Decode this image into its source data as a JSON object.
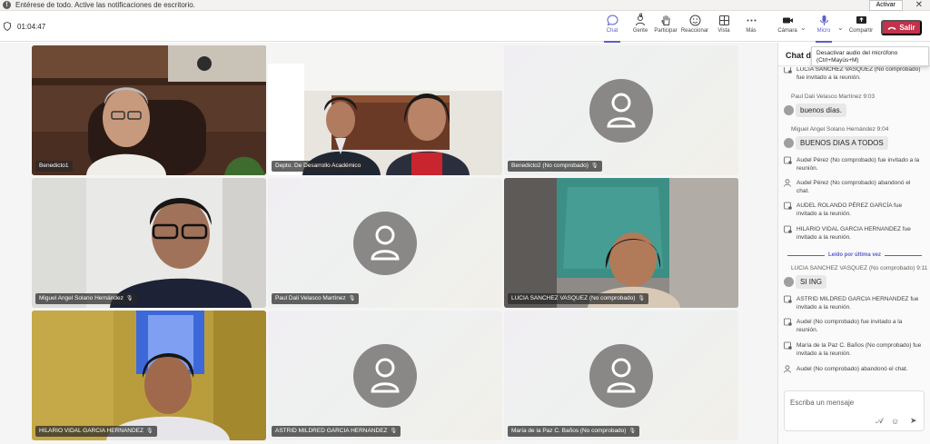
{
  "notification": {
    "text": "Entérese de todo. Active las notificaciones de escritorio.",
    "activate_label": "Activar",
    "close_label": "✕"
  },
  "toolbar": {
    "timer": "01:04:47",
    "people_count": "9",
    "buttons": {
      "chat": "Chat",
      "people": "Gente",
      "participate": "Participar",
      "react": "Reaccionar",
      "view": "Vista",
      "more": "Más",
      "camera": "Cámara",
      "mic": "Micro",
      "share": "Compartir"
    },
    "leave_label": "Salir",
    "leave_color": "#c4314b",
    "accent_color": "#5b5fc7"
  },
  "tooltip": {
    "line1": "Desactivar audio del micrófono",
    "line2": "(Ctrl+Mayús+M)"
  },
  "participants": [
    {
      "name": "Benedicto1",
      "muted": false,
      "video": true
    },
    {
      "name": "Depto. De Desarrollo Académico",
      "muted": false,
      "video": true
    },
    {
      "name": "Benedicto2 (No comprobado)",
      "muted": true,
      "video": false
    },
    {
      "name": "Miguel Angel Solano Hernández",
      "muted": true,
      "video": true
    },
    {
      "name": "Paul Dali Velasco Martínez",
      "muted": true,
      "video": false
    },
    {
      "name": "LUCIA SANCHEZ VASQUEZ (No comprobado)",
      "muted": true,
      "video": true
    },
    {
      "name": "HILARIO VIDAL GARCIA HERNANDEZ",
      "muted": true,
      "video": true
    },
    {
      "name": "ASTRID MILDRED GARCIA HERNANDEZ",
      "muted": true,
      "video": false
    },
    {
      "name": "María de la Paz C. Baños (No comprobado)",
      "muted": true,
      "video": false
    }
  ],
  "chat": {
    "title": "Chat de",
    "top_partial": "LUCIA SANCHEZ VASQUEZ (No comprobado) fue invitado a la reunión.",
    "msg1_meta": "Paul Dali Velasco Martínez  9:03",
    "msg1_text": "buenos días.",
    "msg2_meta": "Miguel Angel Solano Hernández  9:04",
    "msg2_text": "BUENOS DIAS A TODOS",
    "sys1": "Audel Pérez (No comprobado) fue invitado a la reunión.",
    "sys2": "Audel Pérez (No comprobado) abandonó el chat.",
    "sys3": "AUDEL ROLANDO PÉREZ GARCÍA fue invitado a la reunión.",
    "sys4": "HILARIO VIDAL GARCIA HERNANDEZ fue invitado a la reunión.",
    "last_read": "Leído por última vez",
    "msg3_meta": "LUCIA SANCHEZ VASQUEZ (No comprobado)  9:11",
    "msg3_text": "SI ING",
    "sys5": "ASTRID MILDRED GARCIA HERNANDEZ fue invitado a la reunión.",
    "sys6": "Audel (No comprobado) fue invitado a la reunión.",
    "sys7": "María de la Paz C. Baños (No comprobado) fue invitado a la reunión.",
    "sys8": "Audel (No comprobado) abandonó el chat.",
    "compose_placeholder": "Escriba un mensaje"
  }
}
